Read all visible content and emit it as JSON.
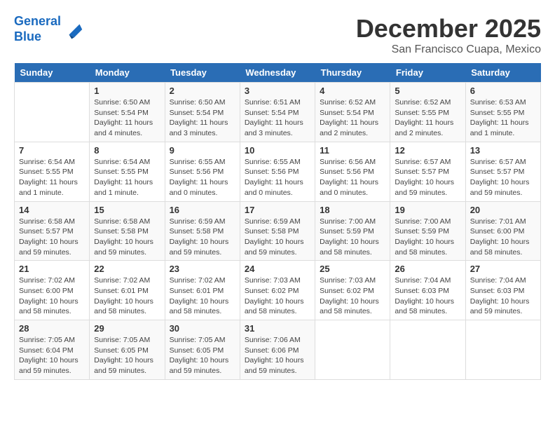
{
  "logo": {
    "line1": "General",
    "line2": "Blue"
  },
  "title": "December 2025",
  "location": "San Francisco Cuapa, Mexico",
  "days_of_week": [
    "Sunday",
    "Monday",
    "Tuesday",
    "Wednesday",
    "Thursday",
    "Friday",
    "Saturday"
  ],
  "weeks": [
    [
      {
        "day": "",
        "info": ""
      },
      {
        "day": "1",
        "info": "Sunrise: 6:50 AM\nSunset: 5:54 PM\nDaylight: 11 hours\nand 4 minutes."
      },
      {
        "day": "2",
        "info": "Sunrise: 6:50 AM\nSunset: 5:54 PM\nDaylight: 11 hours\nand 3 minutes."
      },
      {
        "day": "3",
        "info": "Sunrise: 6:51 AM\nSunset: 5:54 PM\nDaylight: 11 hours\nand 3 minutes."
      },
      {
        "day": "4",
        "info": "Sunrise: 6:52 AM\nSunset: 5:54 PM\nDaylight: 11 hours\nand 2 minutes."
      },
      {
        "day": "5",
        "info": "Sunrise: 6:52 AM\nSunset: 5:55 PM\nDaylight: 11 hours\nand 2 minutes."
      },
      {
        "day": "6",
        "info": "Sunrise: 6:53 AM\nSunset: 5:55 PM\nDaylight: 11 hours\nand 1 minute."
      }
    ],
    [
      {
        "day": "7",
        "info": "Sunrise: 6:54 AM\nSunset: 5:55 PM\nDaylight: 11 hours\nand 1 minute."
      },
      {
        "day": "8",
        "info": "Sunrise: 6:54 AM\nSunset: 5:55 PM\nDaylight: 11 hours\nand 1 minute."
      },
      {
        "day": "9",
        "info": "Sunrise: 6:55 AM\nSunset: 5:56 PM\nDaylight: 11 hours\nand 0 minutes."
      },
      {
        "day": "10",
        "info": "Sunrise: 6:55 AM\nSunset: 5:56 PM\nDaylight: 11 hours\nand 0 minutes."
      },
      {
        "day": "11",
        "info": "Sunrise: 6:56 AM\nSunset: 5:56 PM\nDaylight: 11 hours\nand 0 minutes."
      },
      {
        "day": "12",
        "info": "Sunrise: 6:57 AM\nSunset: 5:57 PM\nDaylight: 10 hours\nand 59 minutes."
      },
      {
        "day": "13",
        "info": "Sunrise: 6:57 AM\nSunset: 5:57 PM\nDaylight: 10 hours\nand 59 minutes."
      }
    ],
    [
      {
        "day": "14",
        "info": "Sunrise: 6:58 AM\nSunset: 5:57 PM\nDaylight: 10 hours\nand 59 minutes."
      },
      {
        "day": "15",
        "info": "Sunrise: 6:58 AM\nSunset: 5:58 PM\nDaylight: 10 hours\nand 59 minutes."
      },
      {
        "day": "16",
        "info": "Sunrise: 6:59 AM\nSunset: 5:58 PM\nDaylight: 10 hours\nand 59 minutes."
      },
      {
        "day": "17",
        "info": "Sunrise: 6:59 AM\nSunset: 5:58 PM\nDaylight: 10 hours\nand 59 minutes."
      },
      {
        "day": "18",
        "info": "Sunrise: 7:00 AM\nSunset: 5:59 PM\nDaylight: 10 hours\nand 58 minutes."
      },
      {
        "day": "19",
        "info": "Sunrise: 7:00 AM\nSunset: 5:59 PM\nDaylight: 10 hours\nand 58 minutes."
      },
      {
        "day": "20",
        "info": "Sunrise: 7:01 AM\nSunset: 6:00 PM\nDaylight: 10 hours\nand 58 minutes."
      }
    ],
    [
      {
        "day": "21",
        "info": "Sunrise: 7:02 AM\nSunset: 6:00 PM\nDaylight: 10 hours\nand 58 minutes."
      },
      {
        "day": "22",
        "info": "Sunrise: 7:02 AM\nSunset: 6:01 PM\nDaylight: 10 hours\nand 58 minutes."
      },
      {
        "day": "23",
        "info": "Sunrise: 7:02 AM\nSunset: 6:01 PM\nDaylight: 10 hours\nand 58 minutes."
      },
      {
        "day": "24",
        "info": "Sunrise: 7:03 AM\nSunset: 6:02 PM\nDaylight: 10 hours\nand 58 minutes."
      },
      {
        "day": "25",
        "info": "Sunrise: 7:03 AM\nSunset: 6:02 PM\nDaylight: 10 hours\nand 58 minutes."
      },
      {
        "day": "26",
        "info": "Sunrise: 7:04 AM\nSunset: 6:03 PM\nDaylight: 10 hours\nand 58 minutes."
      },
      {
        "day": "27",
        "info": "Sunrise: 7:04 AM\nSunset: 6:03 PM\nDaylight: 10 hours\nand 59 minutes."
      }
    ],
    [
      {
        "day": "28",
        "info": "Sunrise: 7:05 AM\nSunset: 6:04 PM\nDaylight: 10 hours\nand 59 minutes."
      },
      {
        "day": "29",
        "info": "Sunrise: 7:05 AM\nSunset: 6:05 PM\nDaylight: 10 hours\nand 59 minutes."
      },
      {
        "day": "30",
        "info": "Sunrise: 7:05 AM\nSunset: 6:05 PM\nDaylight: 10 hours\nand 59 minutes."
      },
      {
        "day": "31",
        "info": "Sunrise: 7:06 AM\nSunset: 6:06 PM\nDaylight: 10 hours\nand 59 minutes."
      },
      {
        "day": "",
        "info": ""
      },
      {
        "day": "",
        "info": ""
      },
      {
        "day": "",
        "info": ""
      }
    ]
  ]
}
